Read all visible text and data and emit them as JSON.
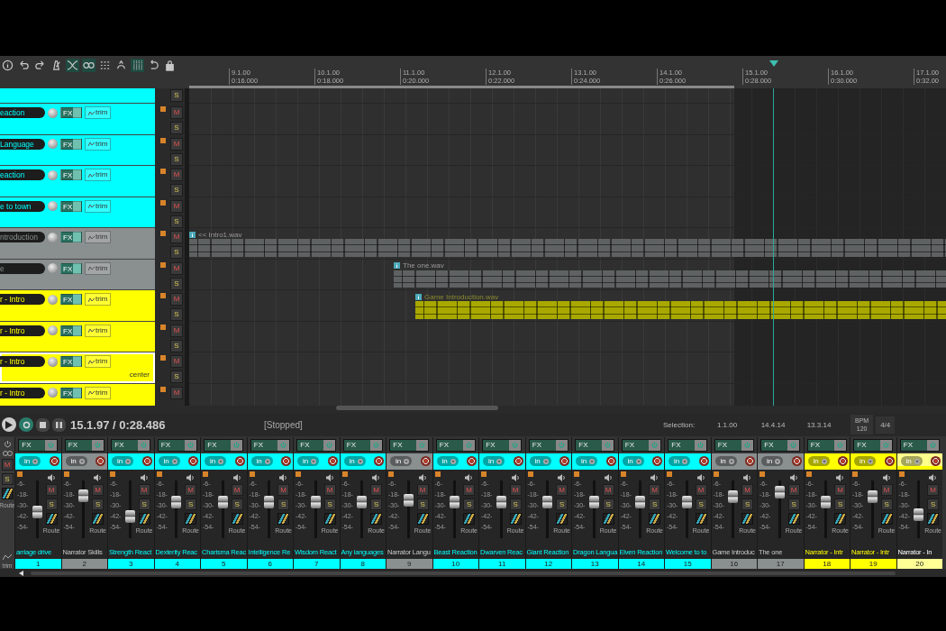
{
  "toolbar": [
    {
      "kind": "info",
      "active": false
    },
    {
      "kind": "undo",
      "active": false
    },
    {
      "kind": "redo",
      "active": false
    },
    {
      "kind": "metronome",
      "active": false
    },
    {
      "kind": "crossfade",
      "active": true
    },
    {
      "kind": "link",
      "active": true
    },
    {
      "kind": "dots",
      "active": false
    },
    {
      "kind": "ripple",
      "active": false
    },
    {
      "kind": "grid",
      "active": true
    },
    {
      "kind": "loop",
      "active": false
    },
    {
      "kind": "lock",
      "active": false
    }
  ],
  "ruler": [
    {
      "bar": "9.1.00",
      "time": "0:16.000"
    },
    {
      "bar": "10.1.00",
      "time": "0:18.000"
    },
    {
      "bar": "11.1.00",
      "time": "0:20.000"
    },
    {
      "bar": "12.1.00",
      "time": "0:22.000"
    },
    {
      "bar": "13.1.00",
      "time": "0:24.000"
    },
    {
      "bar": "14.1.00",
      "time": "0:26.000"
    },
    {
      "bar": "15.1.00",
      "time": "0:28.000"
    },
    {
      "bar": "16.1.00",
      "time": "0:30.000"
    },
    {
      "bar": "17.1.00",
      "time": "0:32.00"
    }
  ],
  "tracks": [
    {
      "color": "#00ffff",
      "selected": false,
      "solo": "S"
    },
    {
      "name": "eaction",
      "color": "#00ffff",
      "selected": false,
      "fx": "FX",
      "trim": "trim",
      "mute": "M",
      "solo": "S"
    },
    {
      "name": "Language",
      "color": "#00ffff",
      "selected": false,
      "fx": "FX",
      "trim": "trim",
      "mute": "M",
      "solo": "S"
    },
    {
      "name": "eaction",
      "color": "#00ffff",
      "selected": false,
      "fx": "FX",
      "trim": "trim",
      "mute": "M",
      "solo": "S"
    },
    {
      "name": "e to town",
      "color": "#00ffff",
      "selected": false,
      "fx": "FX",
      "trim": "trim",
      "mute": "M",
      "solo": "S"
    },
    {
      "name": "ntroduction",
      "color": "#8a8f8f",
      "selected": false,
      "fx": "FX",
      "trim": "trim",
      "mute": "M",
      "solo": "S",
      "item": "<< Intro1.wav"
    },
    {
      "name": "e",
      "color": "#8a8f8f",
      "selected": false,
      "fx": "FX",
      "trim": "trim",
      "mute": "M",
      "solo": "S",
      "item": "The one.wav"
    },
    {
      "name": "r - Intro",
      "color": "#ffff00",
      "selected": false,
      "fx": "FX",
      "trim": "trim",
      "mute": "M",
      "solo": "S",
      "item": "Game Introduction.wav"
    },
    {
      "name": "r - Intro",
      "color": "#ffff00",
      "selected": false,
      "fx": "FX",
      "trim": "trim",
      "mute": "M",
      "solo": "S"
    },
    {
      "name": "r - Intro",
      "color": "#ffff00",
      "selected": true,
      "fx": "FX",
      "trim": "trim",
      "mute": "M",
      "solo": "S",
      "pan_label": "center"
    },
    {
      "name": "r - Intro",
      "color": "#ffff00",
      "selected": false,
      "fx": "FX",
      "trim": "trim",
      "mute": "M"
    }
  ],
  "transport": {
    "repeat": true,
    "position": "15.1.97 / 0:28.486",
    "status": "[Stopped]",
    "selection_label": "Selection:",
    "selection": [
      "1.1.00",
      "14.4.14",
      "13.3.14"
    ],
    "bpm_label": "BPM",
    "bpm": "120",
    "signature": "4/4"
  },
  "master": {
    "mute": "M",
    "solo": "S",
    "route_label": "Route",
    "trim_label": "trim"
  },
  "strips": [
    {
      "name": "arriage drive",
      "number": "1",
      "color": "#00ffff",
      "selected": false,
      "level": 0.45,
      "fx": "FX",
      "input": "in",
      "scale": [
        "-6-",
        "-18-",
        "-30-",
        "-42-",
        "-54-"
      ],
      "mute": "M",
      "solo": "S",
      "route": "Route"
    },
    {
      "name": "Narrator Skills",
      "number": "2",
      "color": "#8a8f8f",
      "selected": false,
      "level": 0.8,
      "fx": "FX",
      "input": "in",
      "scale": [
        "-6-",
        "-18-",
        "-30-",
        "-42-",
        "-54-"
      ],
      "mute": "M",
      "solo": "S",
      "route": "Route"
    },
    {
      "name": "Strength React",
      "number": "3",
      "color": "#00ffff",
      "selected": false,
      "level": 0.35,
      "fx": "FX",
      "input": "in",
      "scale": [
        "-6-",
        "-18-",
        "-30-",
        "-42-",
        "-54-"
      ],
      "mute": "M",
      "solo": "S",
      "route": "Route"
    },
    {
      "name": "Dexterity Reac",
      "number": "4",
      "color": "#00ffff",
      "selected": false,
      "level": 0.66,
      "fx": "FX",
      "input": "in",
      "scale": [
        "-6-",
        "-18-",
        "-30-",
        "-42-",
        "-54-"
      ],
      "mute": "M",
      "solo": "S",
      "route": "Route"
    },
    {
      "name": "Charisma Reac",
      "number": "5",
      "color": "#00ffff",
      "selected": false,
      "level": 0.66,
      "fx": "FX",
      "input": "in",
      "scale": [
        "-6-",
        "-18-",
        "-30-",
        "-42-",
        "-54-"
      ],
      "mute": "M",
      "solo": "S",
      "route": "Route"
    },
    {
      "name": "Intelligence Re",
      "number": "6",
      "color": "#00ffff",
      "selected": false,
      "level": 0.66,
      "fx": "FX",
      "input": "in",
      "scale": [
        "-6-",
        "-18-",
        "-30-",
        "-42-",
        "-54-"
      ],
      "mute": "M",
      "solo": "S",
      "route": "Route"
    },
    {
      "name": "Wisdom React",
      "number": "7",
      "color": "#00ffff",
      "selected": false,
      "level": 0.66,
      "fx": "FX",
      "input": "in",
      "scale": [
        "-6-",
        "-18-",
        "-30-",
        "-42-",
        "-54-"
      ],
      "mute": "M",
      "solo": "S",
      "route": "Route"
    },
    {
      "name": "Any languages",
      "number": "8",
      "color": "#00ffff",
      "selected": false,
      "level": 0.66,
      "fx": "FX",
      "input": "in",
      "scale": [
        "-6-",
        "-18-",
        "-30-",
        "-42-",
        "-54-"
      ],
      "mute": "M",
      "solo": "S",
      "route": "Route"
    },
    {
      "name": "Narrator Langu",
      "number": "9",
      "color": "#8a8f8f",
      "selected": false,
      "level": 0.7,
      "fx": "FX",
      "input": "in",
      "scale": [
        "-6-",
        "-18-",
        "-30-",
        "-42-",
        "-54-"
      ],
      "mute": "M",
      "solo": "S",
      "route": "Route"
    },
    {
      "name": "Beast Reaction",
      "number": "10",
      "color": "#00ffff",
      "selected": false,
      "level": 0.66,
      "fx": "FX",
      "input": "in",
      "scale": [
        "-6-",
        "-18-",
        "-30-",
        "-42-",
        "-54-"
      ],
      "mute": "M",
      "solo": "S",
      "route": "Route"
    },
    {
      "name": "Dwarven Reac",
      "number": "11",
      "color": "#00ffff",
      "selected": false,
      "level": 0.66,
      "fx": "FX",
      "input": "in",
      "scale": [
        "-6-",
        "-18-",
        "-30-",
        "-42-",
        "-54-"
      ],
      "mute": "M",
      "solo": "S",
      "route": "Route"
    },
    {
      "name": "Giant Reaction",
      "number": "12",
      "color": "#00ffff",
      "selected": false,
      "level": 0.66,
      "fx": "FX",
      "input": "in",
      "scale": [
        "-6-",
        "-18-",
        "-30-",
        "-42-",
        "-54-"
      ],
      "mute": "M",
      "solo": "S",
      "route": "Route"
    },
    {
      "name": "Dragon Langua",
      "number": "13",
      "color": "#00ffff",
      "selected": false,
      "level": 0.66,
      "fx": "FX",
      "input": "in",
      "scale": [
        "-6-",
        "-18-",
        "-30-",
        "-42-",
        "-54-"
      ],
      "mute": "M",
      "solo": "S",
      "route": "Route"
    },
    {
      "name": "Elven Reaction",
      "number": "14",
      "color": "#00ffff",
      "selected": false,
      "level": 0.66,
      "fx": "FX",
      "input": "in",
      "scale": [
        "-6-",
        "-18-",
        "-30-",
        "-42-",
        "-54-"
      ],
      "mute": "M",
      "solo": "S",
      "route": "Route"
    },
    {
      "name": "Welcome to to",
      "number": "15",
      "color": "#00ffff",
      "selected": false,
      "level": 0.66,
      "fx": "FX",
      "input": "in",
      "scale": [
        "-6-",
        "-18-",
        "-30-",
        "-42-",
        "-54-"
      ],
      "mute": "M",
      "solo": "S",
      "route": "Route"
    },
    {
      "name": "Game Introduc",
      "number": "16",
      "color": "#8a8f8f",
      "selected": false,
      "level": 0.78,
      "fx": "FX",
      "input": "in",
      "scale": [
        "-6-",
        "-18-",
        "-30-",
        "-42-",
        "-54-"
      ],
      "mute": "M",
      "solo": "S",
      "route": "Route"
    },
    {
      "name": "The one",
      "number": "17",
      "color": "#8a8f8f",
      "selected": false,
      "level": 0.88,
      "fx": "FX",
      "input": "in",
      "scale": [
        "-6-",
        "-18-",
        "-30-",
        "-42-",
        "-54-"
      ],
      "mute": "M",
      "solo": "S",
      "route": "Route"
    },
    {
      "name": "Narrator - Intr",
      "number": "18",
      "color": "#ffff00",
      "selected": false,
      "level": 0.66,
      "fx": "FX",
      "input": "in",
      "scale": [
        "-6-",
        "-18-",
        "-30-",
        "-42-",
        "-54-"
      ],
      "mute": "M",
      "solo": "S",
      "route": "Route"
    },
    {
      "name": "Narrator - Intr",
      "number": "19",
      "color": "#ffff00",
      "selected": false,
      "level": 0.78,
      "fx": "FX",
      "input": "in",
      "scale": [
        "-6-",
        "-18-",
        "-30-",
        "-42-",
        "-54-"
      ],
      "mute": "M",
      "solo": "S",
      "route": "Route"
    },
    {
      "name": "Narrator - In",
      "number": "20",
      "color": "#ffff00",
      "selected": true,
      "level": 0.4,
      "fx": "FX",
      "input": "in",
      "scale": [
        "-6-",
        "-18-",
        "-30-",
        "-42-",
        "-54-"
      ],
      "mute": "M",
      "solo": "S",
      "route": "Route"
    }
  ]
}
